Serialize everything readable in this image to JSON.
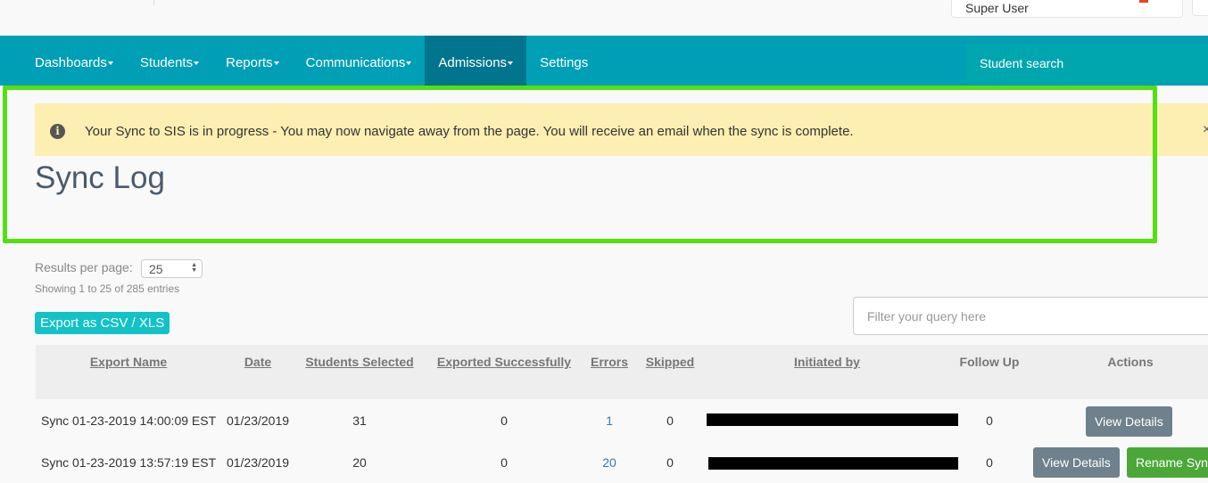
{
  "header": {
    "user": "Super User"
  },
  "nav": {
    "items": [
      {
        "label": "Dashboards",
        "dropdown": true
      },
      {
        "label": "Students",
        "dropdown": true
      },
      {
        "label": "Reports",
        "dropdown": true
      },
      {
        "label": "Communications",
        "dropdown": true
      },
      {
        "label": "Admissions",
        "dropdown": true,
        "active": true
      },
      {
        "label": "Settings",
        "dropdown": false
      }
    ],
    "search_label": "Student search"
  },
  "alert": {
    "text": "Your Sync to SIS is in progress - You may now navigate away from the page. You will receive an email when the sync is complete.",
    "close": "×"
  },
  "page": {
    "title": "Sync Log",
    "results_label": "Results per page:",
    "results_value": "25",
    "showing": "Showing 1 to 25 of 285 entries",
    "export_label": "Export as CSV / XLS",
    "filter_placeholder": "Filter your query here"
  },
  "table": {
    "columns": [
      "Export Name",
      "Date",
      "Students Selected",
      "Exported Successfully",
      "Errors",
      "Skipped",
      "Initiated by",
      "Follow Up",
      "Actions"
    ],
    "rows": [
      {
        "name": "Sync 01-23-2019 14:00:09 EST",
        "date": "01/23/2019",
        "selected": "31",
        "exported": "0",
        "errors": "1",
        "skipped": "0",
        "follow": "0",
        "actions": [
          "View Details"
        ]
      },
      {
        "name": "Sync 01-23-2019 13:57:19 EST",
        "date": "01/23/2019",
        "selected": "20",
        "exported": "0",
        "errors": "20",
        "skipped": "0",
        "follow": "0",
        "actions": [
          "View Details",
          "Rename Sync"
        ]
      }
    ]
  },
  "colors": {
    "nav": "#009fb5",
    "nav_active": "#00758d",
    "alert": "#fdeeb2",
    "highlight": "#55e011",
    "export": "#13c2c6",
    "btn_grey": "#6e818c",
    "btn_green": "#4ba838"
  }
}
